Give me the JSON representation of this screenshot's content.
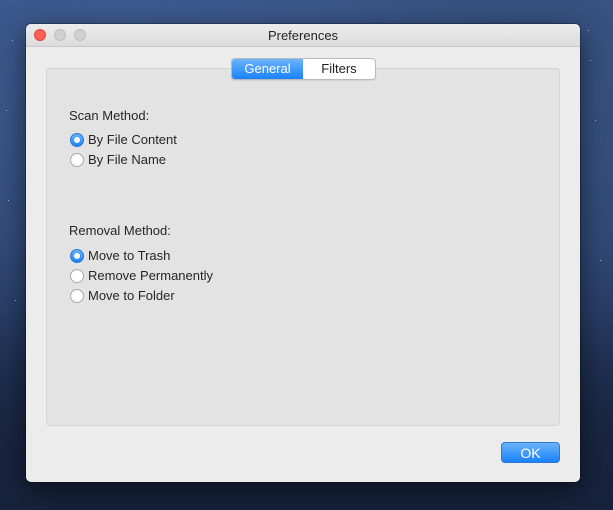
{
  "window": {
    "title": "Preferences"
  },
  "tabs": [
    {
      "label": "General",
      "active": true
    },
    {
      "label": "Filters",
      "active": false
    }
  ],
  "scan_method": {
    "label": "Scan Method:",
    "options": [
      {
        "label": "By File Content",
        "selected": true
      },
      {
        "label": "By File Name",
        "selected": false
      }
    ]
  },
  "removal_method": {
    "label": "Removal Method:",
    "options": [
      {
        "label": "Move to Trash",
        "selected": true
      },
      {
        "label": "Remove Permanently",
        "selected": false
      },
      {
        "label": "Move to Folder",
        "selected": false
      }
    ]
  },
  "buttons": {
    "ok_label": "OK"
  },
  "colors": {
    "accent": "#1a82fb",
    "close": "#fc5f57"
  }
}
